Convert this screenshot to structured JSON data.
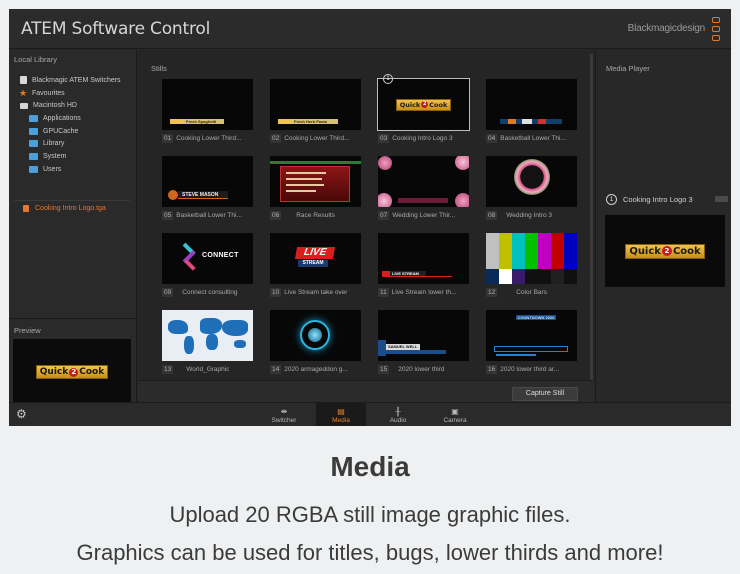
{
  "app": {
    "title": "ATEM Software Control",
    "brand": "Blackmagicdesign"
  },
  "sidebar": {
    "library_label": "Local Library",
    "tree": [
      {
        "label": "Blackmagic ATEM Switchers",
        "icon": "document-icon",
        "indent": 0
      },
      {
        "label": "Favourites",
        "icon": "star-icon",
        "indent": 0
      },
      {
        "label": "Macintosh HD",
        "icon": "drive-icon",
        "indent": 0
      },
      {
        "label": "Applications",
        "icon": "folder-icon",
        "indent": 1
      },
      {
        "label": "GPUCache",
        "icon": "folder-icon",
        "indent": 1
      },
      {
        "label": "Library",
        "icon": "folder-icon",
        "indent": 1
      },
      {
        "label": "System",
        "icon": "folder-icon",
        "indent": 1
      },
      {
        "label": "Users",
        "icon": "folder-icon",
        "indent": 1
      }
    ],
    "selected_file": "Cooking Intro Logo.tga",
    "preview_label": "Preview"
  },
  "logo_text": {
    "a": "Quick",
    "two": "2",
    "b": "Cook"
  },
  "stills": {
    "label": "Stills",
    "selected_badge": "1",
    "capture_label": "Capture Still",
    "items": [
      {
        "num": "01",
        "name": "Cooking Lower Third..."
      },
      {
        "num": "02",
        "name": "Cooking Lower Third..."
      },
      {
        "num": "03",
        "name": "Cooking Intro Logo 3"
      },
      {
        "num": "04",
        "name": "Basketball Lower Thi..."
      },
      {
        "num": "05",
        "name": "Basketball Lower Thi..."
      },
      {
        "num": "06",
        "name": "Race Results"
      },
      {
        "num": "07",
        "name": "Wedding Lower Thir..."
      },
      {
        "num": "08",
        "name": "Wedding Intro 3"
      },
      {
        "num": "09",
        "name": "Connect consulting"
      },
      {
        "num": "10",
        "name": "Live Stream take over"
      },
      {
        "num": "11",
        "name": "Live Stream lower th..."
      },
      {
        "num": "12",
        "name": "Color Bars"
      },
      {
        "num": "13",
        "name": "World_Graphic"
      },
      {
        "num": "14",
        "name": "2020 armageddon g..."
      },
      {
        "num": "15",
        "name": "2020 lower third"
      },
      {
        "num": "16",
        "name": "2020 lower third ar..."
      }
    ],
    "thumb_text": {
      "cooking_lt1": "Fresh Spaghetti",
      "cooking_lt2": "Fresh Herb Pasta",
      "basketball_name": "STEVE MASON",
      "connect": "CONNECT",
      "live": "LIVE",
      "stream": "STREAM",
      "live_stream": "LIVE STREAM",
      "countdown": "COUNTDOWN 2020",
      "lower_name": "SAMUEL WELL"
    }
  },
  "player": {
    "label": "Media Player",
    "badge": "1",
    "clip_name": "Cooking Intro Logo 3"
  },
  "tabs": [
    {
      "label": "Switcher",
      "icon": "sliders-icon",
      "active": false
    },
    {
      "label": "Media",
      "icon": "media-icon",
      "active": true
    },
    {
      "label": "Audio",
      "icon": "audio-icon",
      "active": false
    },
    {
      "label": "Camera",
      "icon": "camera-icon",
      "active": false
    }
  ],
  "caption": {
    "heading": "Media",
    "line1": "Upload 20 RGBA still image graphic files.",
    "line2": "Graphics can be used for titles, bugs, lower thirds and more!"
  },
  "colors": {
    "accent": "#e88326",
    "folder": "#4aa0dc",
    "background": "#262626"
  }
}
